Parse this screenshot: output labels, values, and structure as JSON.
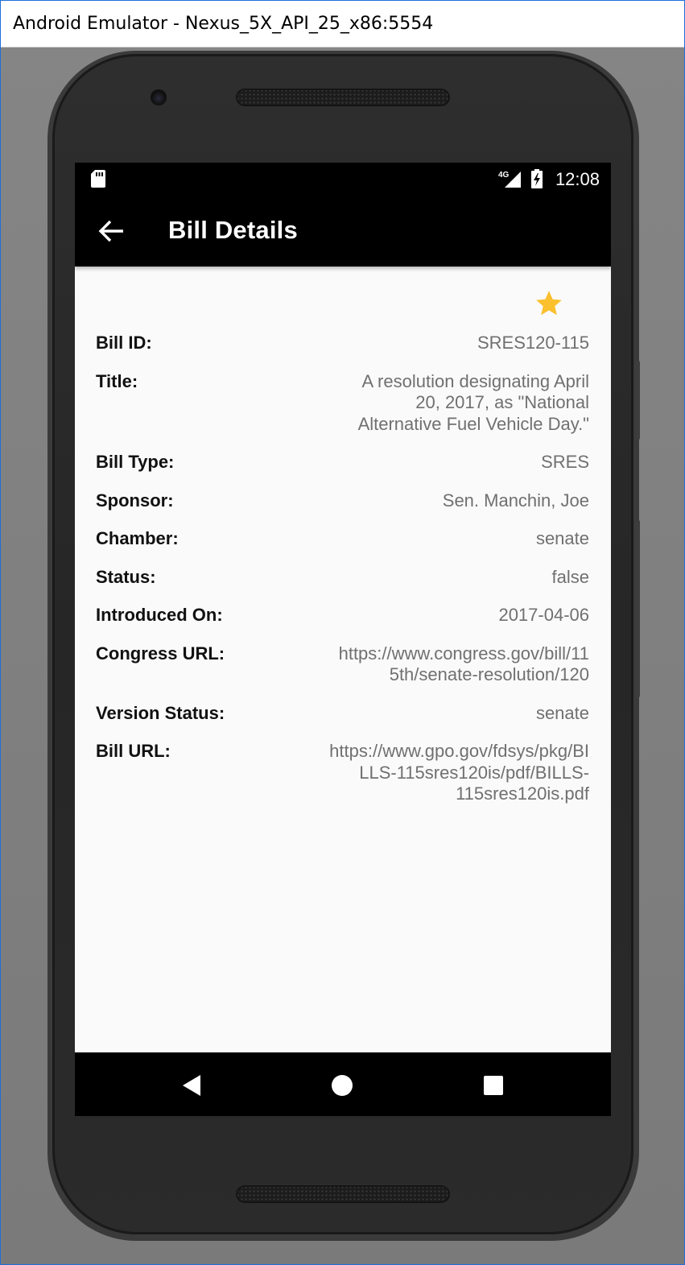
{
  "window": {
    "title": "Android Emulator - Nexus_5X_API_25_x86:5554"
  },
  "status_bar": {
    "time": "12:08",
    "network_label": "4G",
    "icons": [
      "sd-card-icon",
      "signal-4g-icon",
      "battery-charging-icon"
    ]
  },
  "app_bar": {
    "title": "Bill Details",
    "back_icon": "arrow-back-icon"
  },
  "favorite": {
    "icon": "star-icon",
    "color": "#fbc02d",
    "state": "favorited"
  },
  "details": [
    {
      "label": "Bill ID:",
      "value": "SRES120-115"
    },
    {
      "label": "Title:",
      "value": "A resolution designating April 20, 2017, as \"National Alternative Fuel Vehicle Day.\""
    },
    {
      "label": "Bill Type:",
      "value": "SRES"
    },
    {
      "label": "Sponsor:",
      "value": "Sen. Manchin, Joe"
    },
    {
      "label": "Chamber:",
      "value": "senate"
    },
    {
      "label": "Status:",
      "value": "false"
    },
    {
      "label": "Introduced On:",
      "value": "2017-04-06"
    },
    {
      "label": "Congress URL:",
      "value": "https://www.congress.gov/bill/115th/senate-resolution/120"
    },
    {
      "label": "Version Status:",
      "value": "senate"
    },
    {
      "label": "Bill URL:",
      "value": "https://www.gpo.gov/fdsys/pkg/BILLS-115sres120is/pdf/BILLS-115sres120is.pdf"
    }
  ],
  "nav_bar": {
    "icons": [
      "nav-back-icon",
      "nav-home-icon",
      "nav-recents-icon"
    ]
  },
  "colors": {
    "app_bar": "#000000",
    "screen_background": "#fafafa",
    "label_text": "#111111",
    "value_text": "#707070",
    "star": "#fbc02d"
  }
}
